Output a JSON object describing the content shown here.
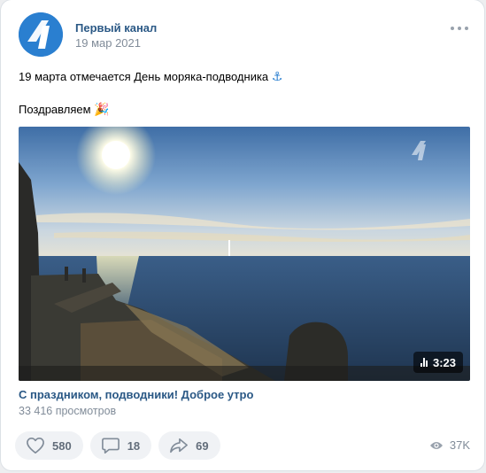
{
  "post": {
    "author": "Первый канал",
    "date": "19 мар 2021",
    "text_line1": "19 марта отмечается День моряка-подводника",
    "emoji_anchor": "⚓",
    "text_line2": "Поздравляем",
    "emoji_party": "🎉"
  },
  "video": {
    "duration": "3:23",
    "title": "С праздником, подводники! Доброе утро",
    "views": "33 416 просмотров"
  },
  "actions": {
    "likes": "580",
    "comments": "18",
    "shares": "69",
    "views": "37K"
  },
  "colors": {
    "link": "#2a5885",
    "secondary": "#818c99",
    "button_bg": "#f0f2f5",
    "channel_blue": "#2a7fd0"
  }
}
